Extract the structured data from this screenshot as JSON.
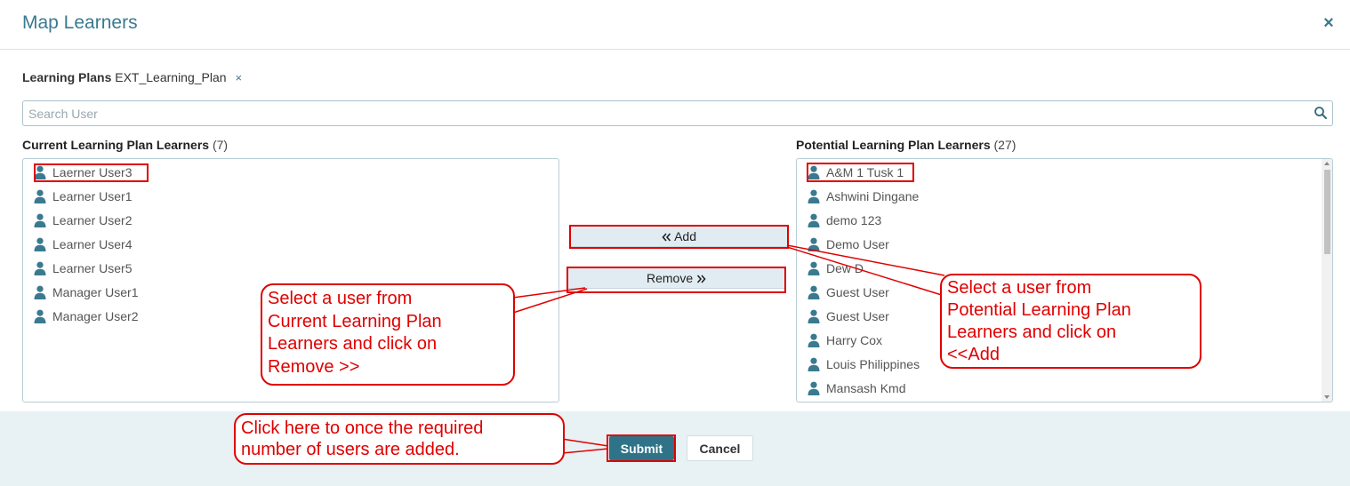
{
  "dialog": {
    "title": "Map Learners",
    "close_symbol": "×"
  },
  "learning_plan": {
    "label": "Learning Plans",
    "value": "EXT_Learning_Plan",
    "remove_symbol": "×"
  },
  "search": {
    "placeholder": "Search User",
    "icon": "search-icon"
  },
  "current": {
    "label": "Current Learning Plan Learners",
    "count": "(7)",
    "items": [
      "Laerner User3",
      "Learner User1",
      "Learner User2",
      "Learner User4",
      "Learner User5",
      "Manager User1",
      "Manager User2"
    ]
  },
  "potential": {
    "label": "Potential Learning Plan Learners",
    "count": "(27)",
    "items": [
      "A&M 1 Tusk 1",
      "Ashwini Dingane",
      "demo 123",
      "Demo User",
      "Dew D",
      "Guest User",
      "Guest User",
      "Harry Cox",
      "Louis Philippines",
      "Mansash Kmd"
    ]
  },
  "actions": {
    "add_label": "Add",
    "add_icon": "double-chevron-left-icon",
    "remove_label": "Remove",
    "remove_icon": "double-chevron-right-icon"
  },
  "footer": {
    "submit_label": "Submit",
    "cancel_label": "Cancel"
  },
  "annotations": {
    "remove_callout": [
      "Select a user from",
      "Current Learning Plan",
      "Learners and click on",
      "Remove >>"
    ],
    "add_callout": [
      "Select a user from",
      "Potential Learning Plan",
      "Learners and click on",
      "<<Add"
    ],
    "submit_callout": [
      "Click here to once the required",
      "number of users are added."
    ]
  },
  "colors": {
    "accent": "#3a7a90",
    "primary_button": "#2f7389",
    "footer_bg": "#e8f1f4",
    "annotation": "#e00000"
  }
}
